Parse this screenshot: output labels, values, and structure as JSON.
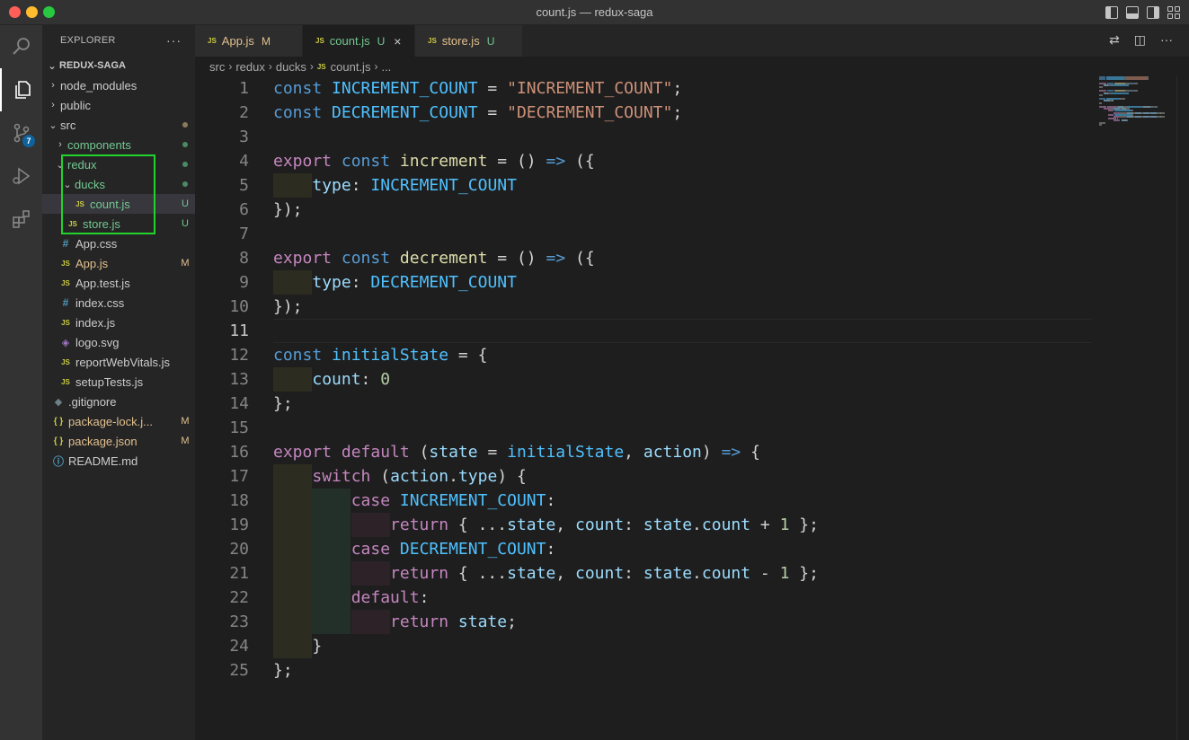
{
  "window": {
    "title": "count.js — redux-saga"
  },
  "activity": {
    "scm_badge": "7"
  },
  "explorer": {
    "header": "EXPLORER",
    "more": "···",
    "project": "REDUX-SAGA",
    "items": [
      {
        "name": "node_modules",
        "type": "folder",
        "open": false,
        "status": ""
      },
      {
        "name": "public",
        "type": "folder",
        "open": false,
        "status": ""
      },
      {
        "name": "src",
        "type": "folder",
        "open": true,
        "status": "dot"
      },
      {
        "name": "components",
        "type": "folder",
        "open": false,
        "status": "dot"
      },
      {
        "name": "redux",
        "type": "folder",
        "open": true,
        "status": "dot"
      },
      {
        "name": "ducks",
        "type": "folder",
        "open": true,
        "status": "dot"
      },
      {
        "name": "count.js",
        "type": "js",
        "status": "U"
      },
      {
        "name": "store.js",
        "type": "js",
        "status": "U"
      },
      {
        "name": "App.css",
        "type": "css",
        "status": ""
      },
      {
        "name": "App.js",
        "type": "js",
        "status": "M"
      },
      {
        "name": "App.test.js",
        "type": "js",
        "status": ""
      },
      {
        "name": "index.css",
        "type": "css",
        "status": ""
      },
      {
        "name": "index.js",
        "type": "js",
        "status": ""
      },
      {
        "name": "logo.svg",
        "type": "svg",
        "status": ""
      },
      {
        "name": "reportWebVitals.js",
        "type": "js",
        "status": ""
      },
      {
        "name": "setupTests.js",
        "type": "js",
        "status": ""
      },
      {
        "name": ".gitignore",
        "type": "git",
        "status": ""
      },
      {
        "name": "package-lock.j...",
        "type": "json",
        "status": "M"
      },
      {
        "name": "package.json",
        "type": "json",
        "status": "M"
      },
      {
        "name": "README.md",
        "type": "info",
        "status": ""
      }
    ]
  },
  "tabs": [
    {
      "label": "App.js",
      "status": "M",
      "active": false
    },
    {
      "label": "count.js",
      "status": "U",
      "active": true
    },
    {
      "label": "store.js",
      "status": "U",
      "active": false
    }
  ],
  "breadcrumbs": [
    "src",
    "redux",
    "ducks",
    "count.js",
    "..."
  ],
  "colors": {
    "keyword": "#569cd6",
    "control": "#c586c0",
    "constant": "#4fc1ff",
    "string": "#ce9178",
    "function": "#dcdcaa",
    "variable": "#9cdcfe",
    "number": "#b5cea8",
    "untracked": "#73c991",
    "modified": "#e2c08d"
  },
  "code": {
    "current_line": 11,
    "lines": [
      [
        [
          "kw",
          "const"
        ],
        [
          "t",
          " "
        ],
        [
          "cst",
          "INCREMENT_COUNT"
        ],
        [
          "t",
          " = "
        ],
        [
          "str",
          "\"INCREMENT_COUNT\""
        ],
        [
          "t",
          ";"
        ]
      ],
      [
        [
          "kw",
          "const"
        ],
        [
          "t",
          " "
        ],
        [
          "cst",
          "DECREMENT_COUNT"
        ],
        [
          "t",
          " = "
        ],
        [
          "str",
          "\"DECREMENT_COUNT\""
        ],
        [
          "t",
          ";"
        ]
      ],
      [],
      [
        [
          "kw2",
          "export"
        ],
        [
          "t",
          " "
        ],
        [
          "kw",
          "const"
        ],
        [
          "t",
          " "
        ],
        [
          "fn",
          "increment"
        ],
        [
          "t",
          " = () "
        ],
        [
          "kw",
          "=>"
        ],
        [
          "t",
          " ({"
        ]
      ],
      [
        [
          "t",
          "    "
        ],
        [
          "var",
          "type"
        ],
        [
          "t",
          ": "
        ],
        [
          "cst",
          "INCREMENT_COUNT"
        ]
      ],
      [
        [
          "t",
          "});"
        ]
      ],
      [],
      [
        [
          "kw2",
          "export"
        ],
        [
          "t",
          " "
        ],
        [
          "kw",
          "const"
        ],
        [
          "t",
          " "
        ],
        [
          "fn",
          "decrement"
        ],
        [
          "t",
          " = () "
        ],
        [
          "kw",
          "=>"
        ],
        [
          "t",
          " ({"
        ]
      ],
      [
        [
          "t",
          "    "
        ],
        [
          "var",
          "type"
        ],
        [
          "t",
          ": "
        ],
        [
          "cst",
          "DECREMENT_COUNT"
        ]
      ],
      [
        [
          "t",
          "});"
        ]
      ],
      [],
      [
        [
          "kw",
          "const"
        ],
        [
          "t",
          " "
        ],
        [
          "cst",
          "initialState"
        ],
        [
          "t",
          " = {"
        ]
      ],
      [
        [
          "t",
          "    "
        ],
        [
          "var",
          "count"
        ],
        [
          "t",
          ": "
        ],
        [
          "num",
          "0"
        ]
      ],
      [
        [
          "t",
          "};"
        ]
      ],
      [],
      [
        [
          "kw2",
          "export"
        ],
        [
          "t",
          " "
        ],
        [
          "kw2",
          "default"
        ],
        [
          "t",
          " ("
        ],
        [
          "var",
          "state"
        ],
        [
          "t",
          " = "
        ],
        [
          "cst",
          "initialState"
        ],
        [
          "t",
          ", "
        ],
        [
          "var",
          "action"
        ],
        [
          "t",
          ") "
        ],
        [
          "kw",
          "=>"
        ],
        [
          "t",
          " {"
        ]
      ],
      [
        [
          "t",
          "    "
        ],
        [
          "kw2",
          "switch"
        ],
        [
          "t",
          " ("
        ],
        [
          "var",
          "action"
        ],
        [
          "t",
          "."
        ],
        [
          "var",
          "type"
        ],
        [
          "t",
          ") {"
        ]
      ],
      [
        [
          "t",
          "        "
        ],
        [
          "kw2",
          "case"
        ],
        [
          "t",
          " "
        ],
        [
          "cst",
          "INCREMENT_COUNT"
        ],
        [
          "t",
          ":"
        ]
      ],
      [
        [
          "t",
          "            "
        ],
        [
          "kw2",
          "return"
        ],
        [
          "t",
          " { ..."
        ],
        [
          "var",
          "state"
        ],
        [
          "t",
          ", "
        ],
        [
          "var",
          "count"
        ],
        [
          "t",
          ": "
        ],
        [
          "var",
          "state"
        ],
        [
          "t",
          "."
        ],
        [
          "var",
          "count"
        ],
        [
          "t",
          " + "
        ],
        [
          "num",
          "1"
        ],
        [
          "t",
          " };"
        ]
      ],
      [
        [
          "t",
          "        "
        ],
        [
          "kw2",
          "case"
        ],
        [
          "t",
          " "
        ],
        [
          "cst",
          "DECREMENT_COUNT"
        ],
        [
          "t",
          ":"
        ]
      ],
      [
        [
          "t",
          "            "
        ],
        [
          "kw2",
          "return"
        ],
        [
          "t",
          " { ..."
        ],
        [
          "var",
          "state"
        ],
        [
          "t",
          ", "
        ],
        [
          "var",
          "count"
        ],
        [
          "t",
          ": "
        ],
        [
          "var",
          "state"
        ],
        [
          "t",
          "."
        ],
        [
          "var",
          "count"
        ],
        [
          "t",
          " - "
        ],
        [
          "num",
          "1"
        ],
        [
          "t",
          " };"
        ]
      ],
      [
        [
          "t",
          "        "
        ],
        [
          "kw2",
          "default"
        ],
        [
          "t",
          ":"
        ]
      ],
      [
        [
          "t",
          "            "
        ],
        [
          "kw2",
          "return"
        ],
        [
          "t",
          " "
        ],
        [
          "var",
          "state"
        ],
        [
          "t",
          ";"
        ]
      ],
      [
        [
          "t",
          "    }"
        ]
      ],
      [
        [
          "t",
          "};"
        ]
      ]
    ]
  }
}
